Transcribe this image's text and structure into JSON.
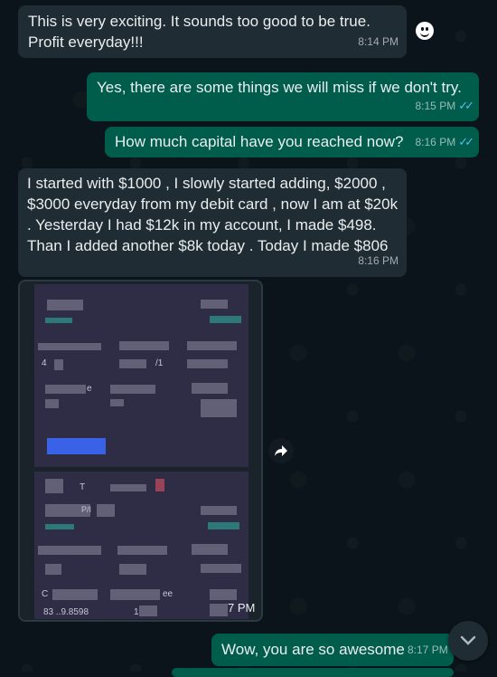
{
  "messages": [
    {
      "direction": "in",
      "text_lines": [
        "This is very exciting. It sounds too good to be true.",
        "Profit everyday!!!"
      ],
      "time": "8:14 PM"
    },
    {
      "direction": "out",
      "text": "Yes, there are some things we will miss if we don't try.",
      "time": "8:15 PM",
      "status": "read"
    },
    {
      "direction": "out",
      "text": "How much capital have you reached now?",
      "time": "8:16 PM",
      "status": "read"
    },
    {
      "direction": "in",
      "text_lines": [
        "I started with $1000 , I slowly started adding, $2000 ,",
        "$3000 everyday from my debit card , now I am at $20k",
        ". Yesterday I had $12k in my account, I made $498.",
        "Than I added another $8k today . Today I made $806"
      ],
      "time": "8:16 PM"
    },
    {
      "direction": "in",
      "type": "image",
      "time_partial": "7 PM",
      "visible_fragments": {
        "ee": "ee",
        "num": "83 ..9.8598",
        "letter_t": "T",
        "letter_c": "C",
        "code": "P/I",
        "digit4": "4",
        "digit1": "1",
        "tick": "/1",
        "e": "e"
      }
    },
    {
      "direction": "out",
      "text": "Wow, you are so awesome",
      "time": "8:17 PM"
    }
  ],
  "icons": {
    "emoji": "emoji-icon",
    "forward": "forward-icon",
    "scroll_down": "chevron-down-icon",
    "read_receipt": "double-check-icon"
  },
  "colors": {
    "incoming": "#202c33",
    "outgoing": "#005c4b",
    "background": "#0b141a",
    "read_tick": "#53bdeb"
  }
}
